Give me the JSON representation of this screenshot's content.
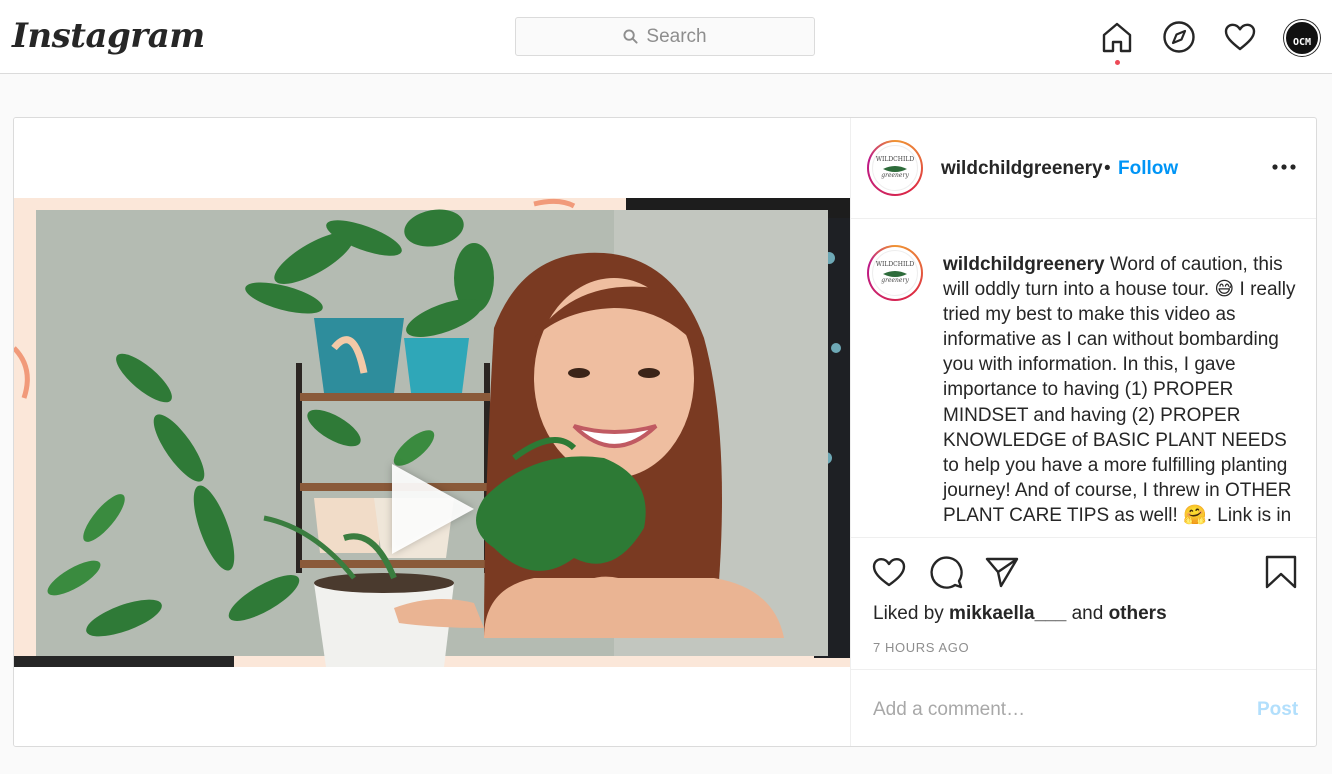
{
  "nav": {
    "logo": "Instagram",
    "search_placeholder": "Search",
    "icons": [
      "home-icon",
      "explore-icon",
      "activity-heart-icon",
      "profile-avatar"
    ],
    "avatar_text": "OCM"
  },
  "post": {
    "username": "wildchildgreenery",
    "separator": "•",
    "follow_label": "Follow",
    "avatar_text_top": "WILDCHILD",
    "avatar_text_bottom": "greenery",
    "caption_user": "wildchildgreenery",
    "caption_text": " Word of caution, this will oddly turn into a house tour. 😅 I really tried my best to make this video as informative as I can without bombarding you with information. In this, I gave importance to having (1) PROPER MINDSET and having (2) PROPER KNOWLEDGE of BASIC PLANT NEEDS to help you have a more fulfilling planting journey! And of course, I threw in OTHER PLANT CARE TIPS as well! 🤗. Link is in",
    "likes_prefix": "Liked by ",
    "liked_by_user": "mikkaella___",
    "likes_middle": " and ",
    "likes_others": "others",
    "timestamp": "7 HOURS AGO",
    "comment_placeholder": "Add a comment…",
    "post_label": "Post"
  },
  "colors": {
    "link_blue": "#0095f6",
    "post_disabled": "#b2dffc",
    "notification_dot": "#ed4956",
    "border": "#dbdbdb"
  }
}
